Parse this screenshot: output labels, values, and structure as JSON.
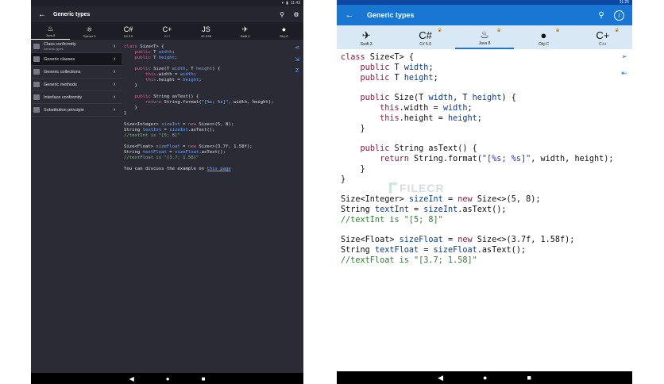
{
  "dark": {
    "status_time": "11:43",
    "title": "Generic types",
    "tabs": [
      {
        "label": "Java 8",
        "glyph": "♨"
      },
      {
        "label": "Python 3",
        "glyph": "⚛"
      },
      {
        "label": "C# 5.5",
        "glyph": "C#"
      },
      {
        "label": "C++",
        "glyph": "C+"
      },
      {
        "label": "JS ES6",
        "glyph": "JS"
      },
      {
        "label": "Swift 4",
        "glyph": "✈"
      },
      {
        "label": "Obj-C",
        "glyph": ""
      }
    ],
    "menu": [
      {
        "label": "Class conformity",
        "sub": "Generic types"
      },
      {
        "label": "Generic classes"
      },
      {
        "label": "Generic collections"
      },
      {
        "label": "Generic methods"
      },
      {
        "label": "Interface conformity"
      },
      {
        "label": "Substitution principle"
      }
    ],
    "footer_text": "You can discuss the example on",
    "footer_link": "this page"
  },
  "light": {
    "status_time": "11:25",
    "title": "Generic types",
    "watermark": "FILECR",
    "tabs": [
      {
        "label": "Swift 3",
        "glyph": "✈"
      },
      {
        "label": "C# 5.0",
        "glyph": "C#"
      },
      {
        "label": "Java 8",
        "glyph": "♨"
      },
      {
        "label": "Obj-C",
        "glyph": ""
      },
      {
        "label": "C++",
        "glyph": "C+"
      }
    ]
  },
  "code": {
    "class_kw": "class",
    "class_decl": " Size<T> {",
    "public": "public",
    "t_type": " T ",
    "width": "width",
    "height": "height",
    "semi": ";",
    "ctor": " Size(T ",
    "comma_t": ", T ",
    "paren_brace": ") {",
    "this": "this",
    "dot_width": ".width = ",
    "dot_height": ".height = ",
    "close_inner": "}",
    "string_method": " String asText() {",
    "return_kw": "return",
    "format_call": " String.format(",
    "format_str": "\"[%s; %s]\"",
    "format_args": ", width, height);",
    "close_outer": "}",
    "size_int_type": "Size<Integer> ",
    "size_int": "sizeInt",
    "new_kw": "new",
    "size_int_rhs": " Size<>(5, 8);",
    "string_kw": "String ",
    "text_int": "textInt",
    "eq": " = ",
    "as_text_int": "sizeInt",
    "as_text_call": ".asText();",
    "cm_int": "//textInt is \"[5; 8]\"",
    "size_float_type": "Size<Float> ",
    "size_float": "sizeFloat",
    "size_float_rhs": " Size<>(3.7f, 1.58f);",
    "text_float": "textFloat",
    "as_text_float": "sizeFloat",
    "cm_float": "//textFloat is \"[3.7; 1.58]\""
  }
}
